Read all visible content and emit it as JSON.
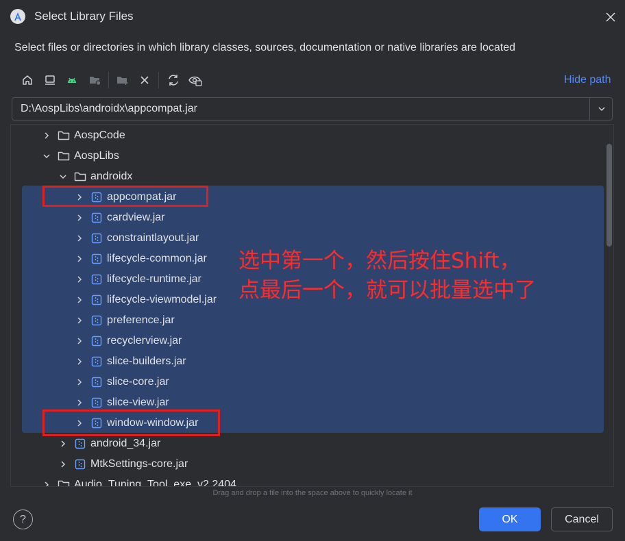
{
  "window": {
    "title": "Select Library Files",
    "close_icon": "close-icon",
    "app_icon": "android-studio-icon"
  },
  "description": "Select files or directories in which library classes, sources, documentation or native libraries are located",
  "toolbar": {
    "buttons": [
      "home-icon",
      "desktop-icon",
      "android-icon",
      "project-folder-icon",
      "new-folder-icon",
      "delete-icon",
      "refresh-icon",
      "show-hidden-icon"
    ],
    "hide_path_label": "Hide path"
  },
  "path_field": {
    "value": "D:\\AospLibs\\androidx\\appcompat.jar"
  },
  "tree": {
    "items": [
      {
        "label": "AospCode",
        "type": "folder",
        "expanded": false
      },
      {
        "label": "AospLibs",
        "type": "folder",
        "expanded": true
      },
      {
        "label": "androidx",
        "type": "folder",
        "expanded": true
      },
      {
        "label": "appcompat.jar",
        "type": "jar",
        "selected": true
      },
      {
        "label": "cardview.jar",
        "type": "jar",
        "selected": true
      },
      {
        "label": "constraintlayout.jar",
        "type": "jar",
        "selected": true
      },
      {
        "label": "lifecycle-common.jar",
        "type": "jar",
        "selected": true
      },
      {
        "label": "lifecycle-runtime.jar",
        "type": "jar",
        "selected": true
      },
      {
        "label": "lifecycle-viewmodel.jar",
        "type": "jar",
        "selected": true
      },
      {
        "label": "preference.jar",
        "type": "jar",
        "selected": true
      },
      {
        "label": "recyclerview.jar",
        "type": "jar",
        "selected": true
      },
      {
        "label": "slice-builders.jar",
        "type": "jar",
        "selected": true
      },
      {
        "label": "slice-core.jar",
        "type": "jar",
        "selected": true
      },
      {
        "label": "slice-view.jar",
        "type": "jar",
        "selected": true
      },
      {
        "label": "window-window.jar",
        "type": "jar",
        "selected": true
      },
      {
        "label": "android_34.jar",
        "type": "jar",
        "selected": false
      },
      {
        "label": "MtkSettings-core.jar",
        "type": "jar",
        "selected": false
      },
      {
        "label": "Audio_Tuning_Tool_exe_v2.2404",
        "type": "folder",
        "expanded": false
      }
    ]
  },
  "annotation": {
    "line1": "选中第一个，然后按住Shift，",
    "line2": "点最后一个，就可以批量选中了",
    "color": "#ff2b2b"
  },
  "hint": "Drag and drop a file into the space above to quickly locate it",
  "footer": {
    "help_label": "?",
    "ok_label": "OK",
    "cancel_label": "Cancel"
  },
  "colors": {
    "background": "#2b2d30",
    "selection": "#2e436e",
    "accent": "#3574f0",
    "link": "#548af7",
    "highlight_box": "#e02020"
  }
}
